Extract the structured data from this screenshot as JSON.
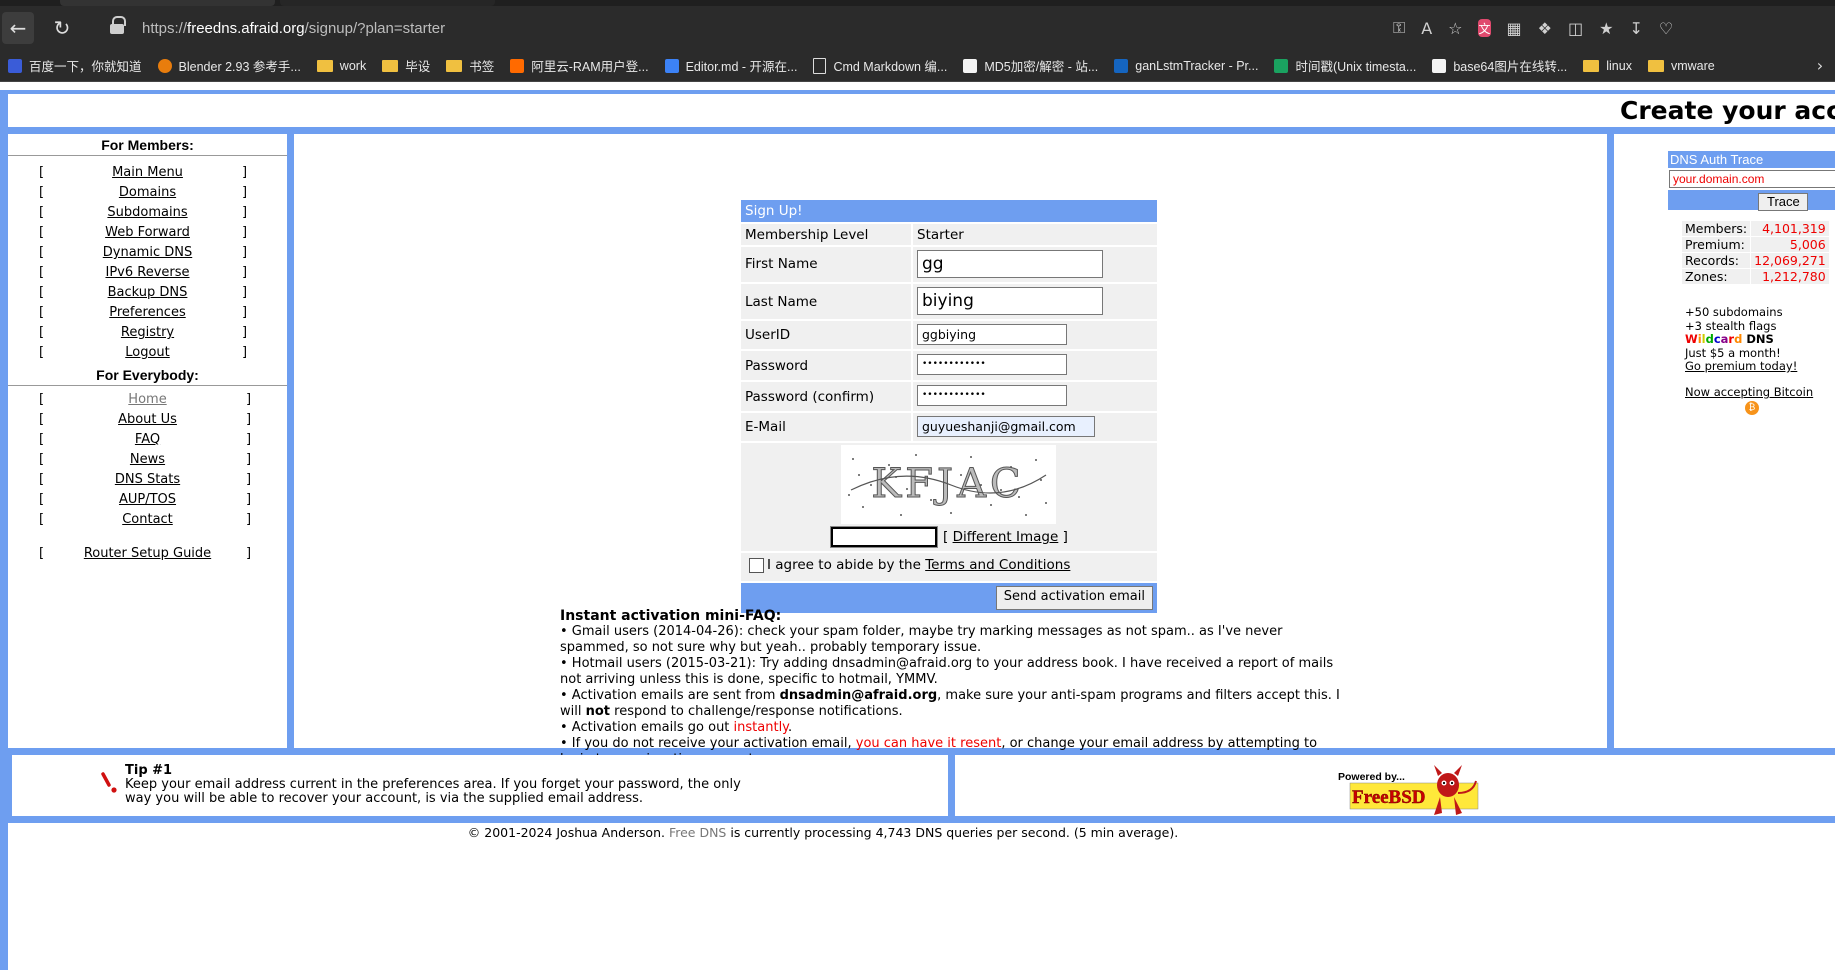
{
  "browser": {
    "url_prefix": "https://",
    "url_host": "freedns.afraid.org",
    "url_path": "/signup/?plan=starter",
    "toolbar_icons": [
      "key-icon",
      "read-aloud-icon",
      "favorite-star-icon",
      "translate-extension-icon",
      "reader-icon",
      "extensions-icon",
      "split-screen-icon",
      "favorites-icon",
      "downloads-icon",
      "performance-icon"
    ]
  },
  "bookmarks": [
    {
      "label": "百度一下，你就知道",
      "icon": "baidu"
    },
    {
      "label": "Blender 2.93 参考手...",
      "icon": "blender"
    },
    {
      "label": "work",
      "icon": "folder"
    },
    {
      "label": "毕设",
      "icon": "folder"
    },
    {
      "label": "书签",
      "icon": "folder"
    },
    {
      "label": "阿里云-RAM用户登...",
      "icon": "ali"
    },
    {
      "label": "Editor.md - 开源在...",
      "icon": "md"
    },
    {
      "label": "Cmd Markdown 编...",
      "icon": "doc"
    },
    {
      "label": "MD5加密/解密 - 站...",
      "icon": "tool"
    },
    {
      "label": "ganLstmTracker - Pr...",
      "icon": "on"
    },
    {
      "label": "时间戳(Unix timesta...",
      "icon": "ts"
    },
    {
      "label": "base64图片在线转...",
      "icon": "tool"
    },
    {
      "label": "linux",
      "icon": "folder"
    },
    {
      "label": "vmware",
      "icon": "folder"
    }
  ],
  "header": {
    "title": "Create your account"
  },
  "members": {
    "title": "For Members:",
    "items": [
      "Main Menu",
      "Domains",
      "Subdomains",
      "Web Forward",
      "Dynamic DNS",
      "IPv6 Reverse",
      "Backup DNS",
      "Preferences",
      "Registry",
      "Logout"
    ]
  },
  "everybody": {
    "title": "For Everybody:",
    "items": [
      "Home",
      "About Us",
      "FAQ",
      "News",
      "DNS Stats",
      "AUP/TOS",
      "Contact"
    ],
    "router_guide": "Router Setup Guide"
  },
  "bracket_open": "[",
  "bracket_close": "]",
  "signup": {
    "header": "Sign Up!",
    "membership_label": "Membership Level",
    "membership_value": "Starter",
    "first_name_label": "First Name",
    "first_name_value": "gg",
    "last_name_label": "Last Name",
    "last_name_value": "biying",
    "userid_label": "UserID",
    "userid_value": "ggbiying",
    "password_label": "Password",
    "password_value": "••••••••••••",
    "password_confirm_label": "Password (confirm)",
    "password_confirm_value": "••••••••••••",
    "email_label": "E-Mail",
    "email_value": "guyueshanji@gmail.com",
    "captcha_text": "KFJAC",
    "different_image": "Different Image",
    "agree_text": "I agree to abide by the ",
    "terms_link": "Terms and Conditions",
    "submit": "Send activation email"
  },
  "faq": {
    "title": "Instant activation mini-FAQ:",
    "item1": "•  Gmail users (2014-04-26): check your spam folder, maybe try marking messages as not spam.. as I've never spammed, so not sure why but yeah.. probably temporary issue.",
    "item2": "•  Hotmail users (2015-03-21): Try adding dnsadmin@afraid.org to your address book. I have received a report of mails not arriving unless this is done, specific to hotmail, YMMV.",
    "item3_a": "•  Activation emails are sent from ",
    "item3_b": "dnsadmin@afraid.org",
    "item3_c": ", make sure your anti-spam programs and filters accept this. I will ",
    "item3_d": "not",
    "item3_e": " respond to challenge/response notifications.",
    "item4_a": "•  Activation emails go out ",
    "item4_b": "instantly",
    "item4_c": ".",
    "item5_a": "•  If you do not receive your activation email, ",
    "item5_b": "you can have it resent",
    "item5_c": ", or change your email address by attempting to login to your inactive account."
  },
  "trace": {
    "header": "DNS Auth Trace",
    "placeholder": "your.domain.com",
    "button": "Trace"
  },
  "stats": [
    {
      "key": "Members:",
      "value": "4,101,319"
    },
    {
      "key": "Premium:",
      "value": "5,006"
    },
    {
      "key": "Records:",
      "value": "12,069,271"
    },
    {
      "key": "Zones:",
      "value": "1,212,780"
    }
  ],
  "promo": {
    "line1": "+50 subdomains",
    "line2": "+3 stealth flags",
    "wildcard_letters": [
      "W",
      "i",
      "l",
      "d",
      "c",
      "a",
      "r",
      "d"
    ],
    "wildcard_colors": [
      "#e00",
      "#f80",
      "#cc0",
      "#0a0",
      "#00c",
      "#808",
      "#e00",
      "#f80"
    ],
    "dns": " DNS",
    "line4": "Just $5 a month!",
    "link": "Go premium today!",
    "bitcoin": "Now accepting Bitcoin",
    "bitcoin_symbol": "₿"
  },
  "tip": {
    "title": "Tip #1",
    "text": "Keep your email address current in the preferences area. If you forget your password, the only way you will be able to recover your account, is via the supplied email address."
  },
  "freebsd": {
    "powered": "Powered by...",
    "name": "FreeBSD"
  },
  "footer": {
    "prefix": "© 2001-2024 Joshua Anderson. ",
    "link": "Free DNS",
    "suffix": " is currently processing 4,743 DNS queries per second. (5 min average)."
  },
  "colors": {
    "accent_blue": "#6e9ef0",
    "red": "#ee0000"
  }
}
